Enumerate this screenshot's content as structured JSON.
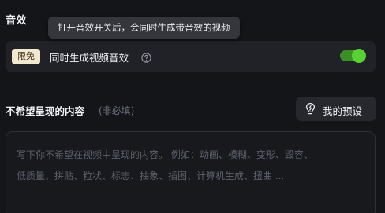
{
  "sound": {
    "title": "音效",
    "tooltip": "打开音效开关后，会同时生成带音效的视频",
    "badge": "限免",
    "label": "同时生成视频音效",
    "help_icon": "question-circle-icon",
    "toggle_on": true,
    "toggle_color": "#58d132"
  },
  "negative": {
    "title": "不希望呈现的内容",
    "optional": "(非必填)",
    "preset_button": "我的预设",
    "preset_icon": "lightbulb-icon",
    "placeholder_line1": "写下你不希望在视频中呈现的内容。 例如：动画、模糊、变形、毁容、",
    "placeholder_line2": "低质量、拼贴、粒状、标志、抽象、插图、计算机生成、扭曲 ..."
  }
}
